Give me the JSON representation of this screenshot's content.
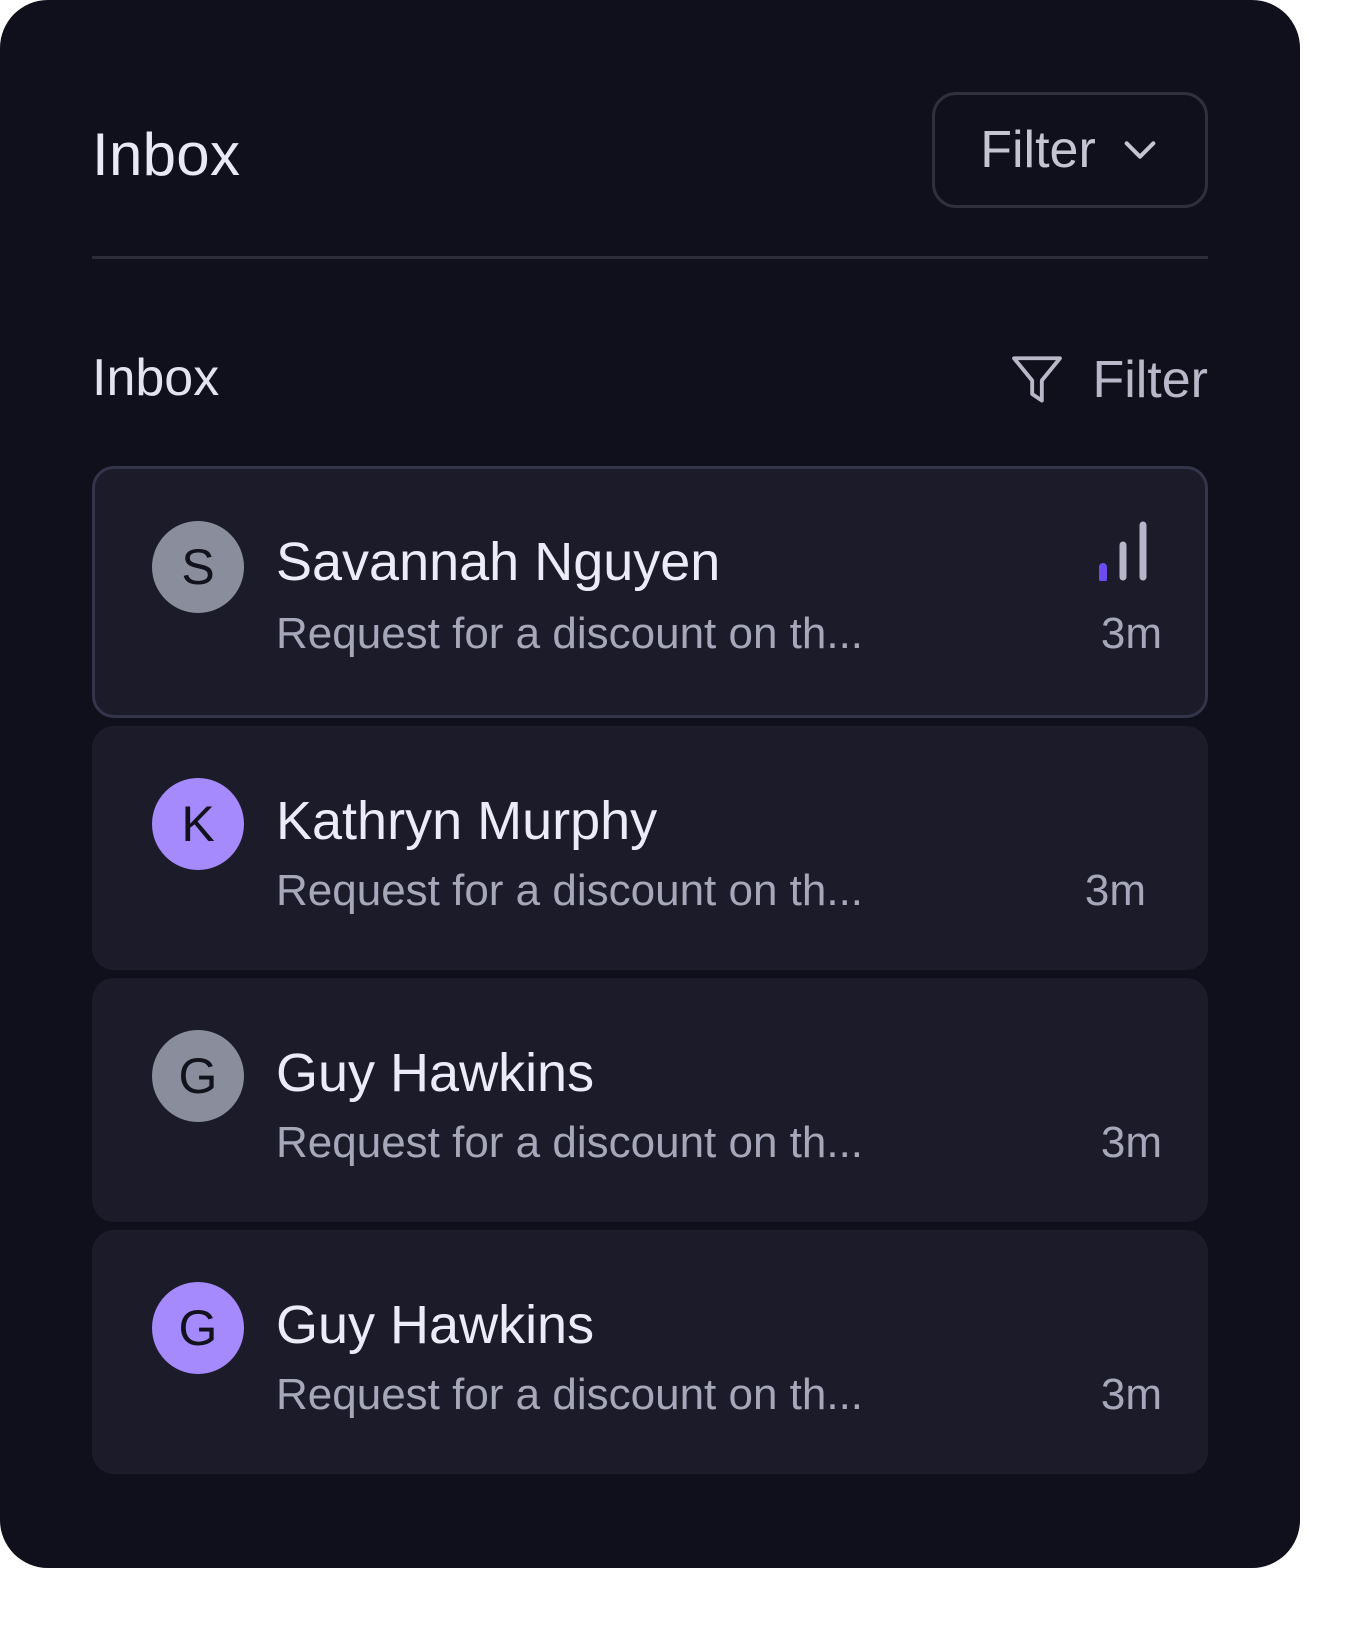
{
  "header": {
    "title": "Inbox",
    "filter_label": "Filter"
  },
  "subheader": {
    "title": "Inbox",
    "filter_label": "Filter"
  },
  "messages": [
    {
      "initial": "S",
      "name": "Savannah Nguyen",
      "preview": "Request for a discount on th...",
      "time": "3m"
    },
    {
      "initial": "K",
      "name": "Kathryn Murphy",
      "preview": "Request for a discount on th...",
      "time": "3m"
    },
    {
      "initial": "G",
      "name": "Guy Hawkins",
      "preview": "Request for a discount on th...",
      "time": "3m"
    },
    {
      "initial": "G",
      "name": "Guy Hawkins",
      "preview": "Request for a discount on th...",
      "time": "3m"
    }
  ],
  "colors": {
    "background": "#10101d",
    "card": "#1b1b2a",
    "avatar_gray": "#8a8d9c",
    "avatar_purple": "#a48afc",
    "accent": "#6a4cf0"
  },
  "icons": {
    "dropdown": "chevron-down-icon",
    "filter": "filter-funnel-icon",
    "priority": "signal-bars-icon"
  }
}
